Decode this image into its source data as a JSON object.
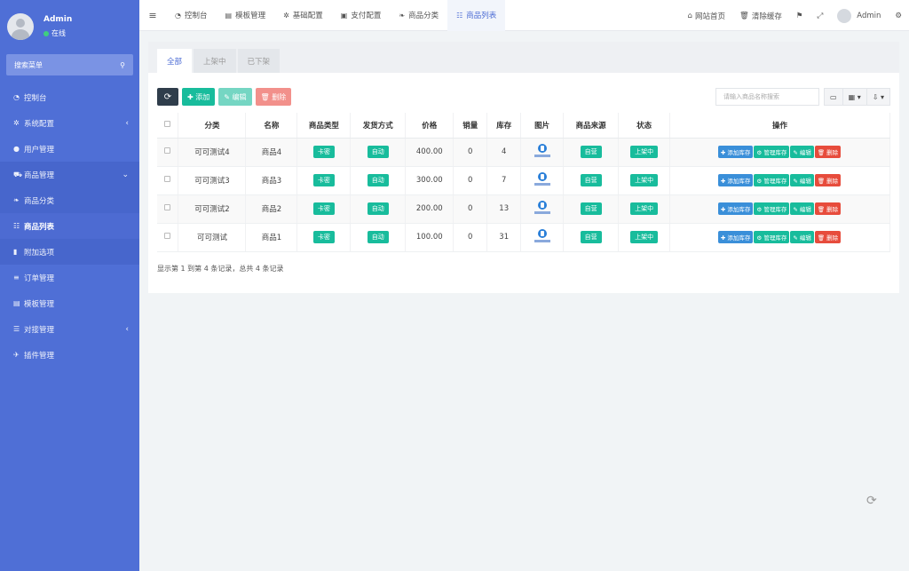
{
  "user": {
    "name": "Admin",
    "status": "在线"
  },
  "sidebar": {
    "search_placeholder": "搜索菜单",
    "items": [
      {
        "icon": "dashboard-icon",
        "glyph": "◔",
        "label": "控制台"
      },
      {
        "icon": "gear-icon",
        "glyph": "✲",
        "label": "系统配置",
        "arrow": "‹"
      },
      {
        "icon": "user-icon",
        "glyph": "●",
        "label": "用户管理"
      },
      {
        "icon": "cart-icon",
        "glyph": "⛟",
        "label": "商品管理",
        "arrow": "⌄"
      },
      {
        "icon": "leaf-icon",
        "glyph": "❧",
        "label": "商品分类"
      },
      {
        "icon": "list-icon",
        "glyph": "☷",
        "label": "商品列表"
      },
      {
        "icon": "bookmark-icon",
        "glyph": "▮",
        "label": "附加选项"
      },
      {
        "icon": "order-icon",
        "glyph": "≡",
        "label": "订单管理"
      },
      {
        "icon": "template-icon",
        "glyph": "▤",
        "label": "模板管理"
      },
      {
        "icon": "plugin-list-icon",
        "glyph": "☰",
        "label": "对接管理",
        "arrow": "‹"
      },
      {
        "icon": "rocket-icon",
        "glyph": "✈",
        "label": "插件管理"
      }
    ]
  },
  "topnav": {
    "tabs": [
      {
        "icon": "dashboard-icon",
        "glyph": "◔",
        "label": "控制台"
      },
      {
        "icon": "template-icon",
        "glyph": "▤",
        "label": "模板管理"
      },
      {
        "icon": "gear-icon",
        "glyph": "✲",
        "label": "基础配置"
      },
      {
        "icon": "wallet-icon",
        "glyph": "▣",
        "label": "支付配置"
      },
      {
        "icon": "leaf-icon",
        "glyph": "❧",
        "label": "商品分类"
      },
      {
        "icon": "list-icon",
        "glyph": "☷",
        "label": "商品列表"
      }
    ],
    "home_label": "网站首页",
    "clear_cache_label": "清除缓存",
    "admin_label": "Admin"
  },
  "panel": {
    "tabs": [
      "全部",
      "上架中",
      "已下架"
    ],
    "toolbar": {
      "refresh": "⟳",
      "add": "✚ 添加",
      "edit": "✎ 编辑",
      "delete": "🗑 删除"
    },
    "search_placeholder": "请输入商品名称搜索",
    "columns": [
      "分类",
      "名称",
      "商品类型",
      "发货方式",
      "价格",
      "销量",
      "库存",
      "图片",
      "商品来源",
      "状态",
      "操作"
    ],
    "rows": [
      {
        "category": "可可测试4",
        "name": "商品4",
        "type": "卡密",
        "delivery": "自动",
        "price": "400.00",
        "sales": "0",
        "stock": "4",
        "source": "自营",
        "status": "上架中"
      },
      {
        "category": "可可测试3",
        "name": "商品3",
        "type": "卡密",
        "delivery": "自动",
        "price": "300.00",
        "sales": "0",
        "stock": "7",
        "source": "自营",
        "status": "上架中"
      },
      {
        "category": "可可测试2",
        "name": "商品2",
        "type": "卡密",
        "delivery": "自动",
        "price": "200.00",
        "sales": "0",
        "stock": "13",
        "source": "自营",
        "status": "上架中"
      },
      {
        "category": "可可测试",
        "name": "商品1",
        "type": "卡密",
        "delivery": "自动",
        "price": "100.00",
        "sales": "0",
        "stock": "31",
        "source": "自营",
        "status": "上架中"
      }
    ],
    "row_actions": {
      "add_stock": "✚ 添加库存",
      "manage_stock": "⚙ 管理库存",
      "edit": "✎ 编辑",
      "delete": "🗑 删除"
    },
    "footer": "显示第 1 到第 4 条记录，总共 4 条记录"
  }
}
